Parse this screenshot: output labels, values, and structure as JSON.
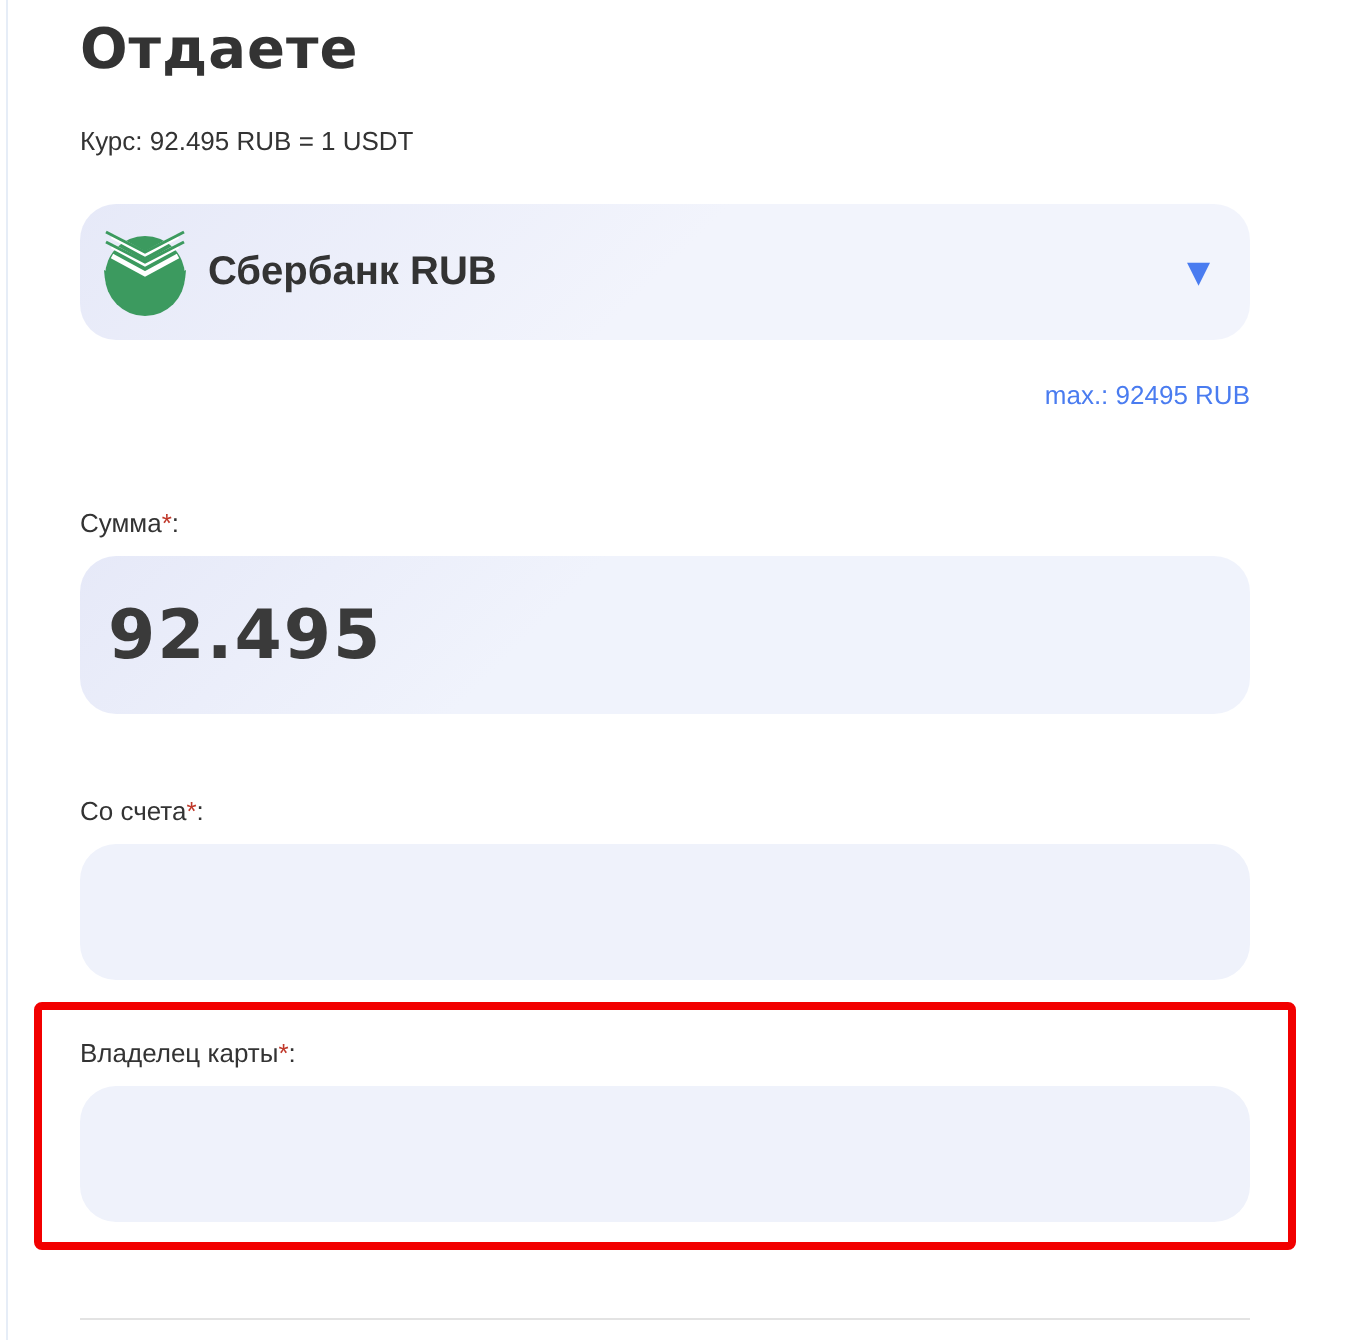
{
  "title": "Отдаете",
  "rate": "Курс: 92.495 RUB = 1 USDT",
  "bank_select": {
    "label": "Сбербанк RUB",
    "caret": "▼"
  },
  "max": "max.: 92495 RUB",
  "fields": [
    {
      "label": "Сумма",
      "required_mark": "*",
      "suffix": ":",
      "value": "92.495",
      "kind": "amount",
      "highlighted": false
    },
    {
      "label": "Со счета",
      "required_mark": "*",
      "suffix": ":",
      "kind": "text",
      "highlighted": false
    },
    {
      "label": "Владелец карты",
      "required_mark": "*",
      "suffix": ":",
      "kind": "text",
      "highlighted": true
    }
  ]
}
